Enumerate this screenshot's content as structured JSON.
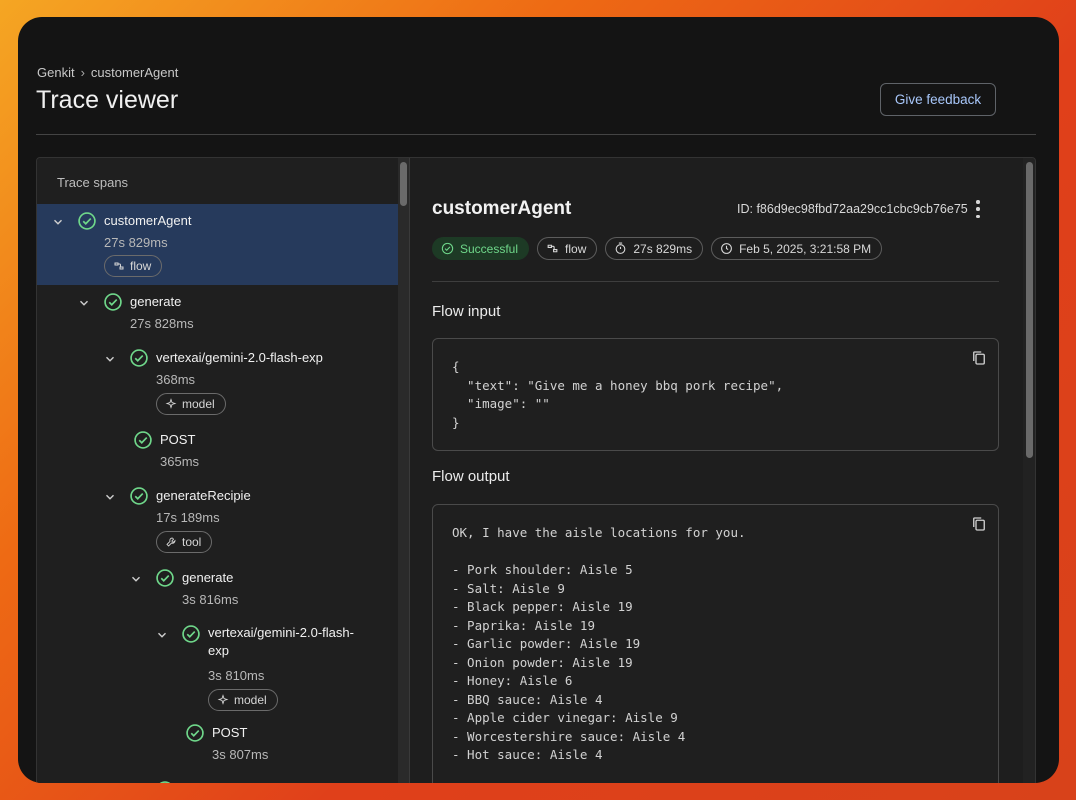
{
  "breadcrumb": {
    "root": "Genkit",
    "current": "customerAgent"
  },
  "page_title": "Trace viewer",
  "feedback_label": "Give feedback",
  "sidebar": {
    "title": "Trace spans",
    "spans": [
      {
        "name": "customerAgent",
        "duration": "27s 829ms",
        "chip": "flow"
      },
      {
        "name": "generate",
        "duration": "27s 828ms"
      },
      {
        "name": "vertexai/gemini-2.0-flash-exp",
        "duration": "368ms",
        "chip": "model"
      },
      {
        "name": "POST",
        "duration": "365ms"
      },
      {
        "name": "generateRecipie",
        "duration": "17s 189ms",
        "chip": "tool"
      },
      {
        "name": "generate",
        "duration": "3s 816ms"
      },
      {
        "name": "vertexai/gemini-2.0-flash-exp",
        "duration": "3s 810ms",
        "chip": "model"
      },
      {
        "name": "POST",
        "duration": "3s 807ms"
      }
    ]
  },
  "detail": {
    "name": "customerAgent",
    "id_text": "ID: f86d9ec98fbd72aa29cc1cbc9cb76e75",
    "status": "Successful",
    "type": "flow",
    "duration": "27s 829ms",
    "timestamp": "Feb 5, 2025, 3:21:58 PM",
    "input_title": "Flow input",
    "input_lines": [
      "{",
      "  \"text\": \"Give me a honey bbq pork recipe\",",
      "  \"image\": \"\"",
      "}"
    ],
    "output_title": "Flow output",
    "output_lines": [
      "OK, I have the aisle locations for you.",
      "",
      "- Pork shoulder: Aisle 5",
      "- Salt: Aisle 9",
      "- Black pepper: Aisle 19",
      "- Paprika: Aisle 19",
      "- Garlic powder: Aisle 19",
      "- Onion powder: Aisle 19",
      "- Honey: Aisle 6",
      "- BBQ sauce: Aisle 4",
      "- Apple cider vinegar: Aisle 9",
      "- Worcestershire sauce: Aisle 4",
      "- Hot sauce: Aisle 4"
    ]
  },
  "colors": {
    "accent": "#a8c7fa",
    "success": "#6fd78a",
    "selected": "#263a5c"
  }
}
